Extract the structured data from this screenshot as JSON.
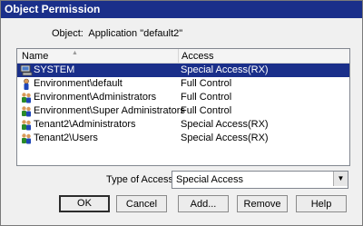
{
  "dialog": {
    "title": "Object Permission",
    "object_label": "Object:  Application \"default2\""
  },
  "list": {
    "columns": [
      "Name",
      "Access"
    ],
    "rows": [
      {
        "name": "SYSTEM",
        "access": "Special Access(RX)",
        "icon": "computer-icon",
        "selected": true
      },
      {
        "name": "Environment\\default",
        "access": "Full Control",
        "icon": "user-icon",
        "selected": false
      },
      {
        "name": "Environment\\Administrators",
        "access": "Full Control",
        "icon": "group-icon",
        "selected": false
      },
      {
        "name": "Environment\\Super Administrators",
        "access": "Full Control",
        "icon": "group-icon",
        "selected": false
      },
      {
        "name": "Tenant2\\Administrators",
        "access": "Special Access(RX)",
        "icon": "group-icon",
        "selected": false
      },
      {
        "name": "Tenant2\\Users",
        "access": "Special Access(RX)",
        "icon": "group-icon",
        "selected": false
      }
    ]
  },
  "type_of_access": {
    "label": "Type of Access:",
    "value": "Special Access"
  },
  "buttons": {
    "ok": "OK",
    "cancel": "Cancel",
    "add": "Add...",
    "remove": "Remove",
    "help": "Help"
  },
  "colors": {
    "title_bar": "#1a2f8a",
    "selection": "#1a2f8a",
    "dialog_bg": "#f0f0f0"
  }
}
